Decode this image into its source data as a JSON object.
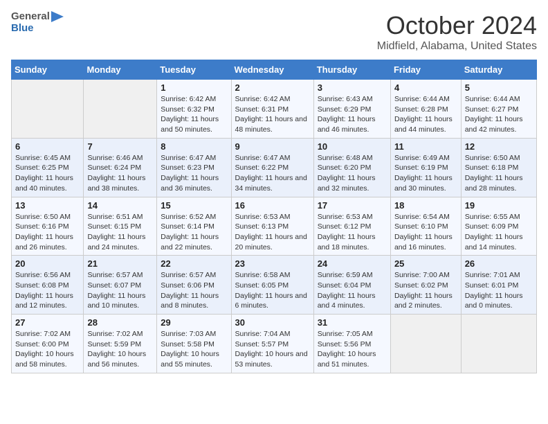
{
  "header": {
    "logo_general": "General",
    "logo_blue": "Blue",
    "month_title": "October 2024",
    "location": "Midfield, Alabama, United States"
  },
  "days_of_week": [
    "Sunday",
    "Monday",
    "Tuesday",
    "Wednesday",
    "Thursday",
    "Friday",
    "Saturday"
  ],
  "weeks": [
    [
      {
        "day": "",
        "info": ""
      },
      {
        "day": "",
        "info": ""
      },
      {
        "day": "1",
        "info": "Sunrise: 6:42 AM\nSunset: 6:32 PM\nDaylight: 11 hours and 50 minutes."
      },
      {
        "day": "2",
        "info": "Sunrise: 6:42 AM\nSunset: 6:31 PM\nDaylight: 11 hours and 48 minutes."
      },
      {
        "day": "3",
        "info": "Sunrise: 6:43 AM\nSunset: 6:29 PM\nDaylight: 11 hours and 46 minutes."
      },
      {
        "day": "4",
        "info": "Sunrise: 6:44 AM\nSunset: 6:28 PM\nDaylight: 11 hours and 44 minutes."
      },
      {
        "day": "5",
        "info": "Sunrise: 6:44 AM\nSunset: 6:27 PM\nDaylight: 11 hours and 42 minutes."
      }
    ],
    [
      {
        "day": "6",
        "info": "Sunrise: 6:45 AM\nSunset: 6:25 PM\nDaylight: 11 hours and 40 minutes."
      },
      {
        "day": "7",
        "info": "Sunrise: 6:46 AM\nSunset: 6:24 PM\nDaylight: 11 hours and 38 minutes."
      },
      {
        "day": "8",
        "info": "Sunrise: 6:47 AM\nSunset: 6:23 PM\nDaylight: 11 hours and 36 minutes."
      },
      {
        "day": "9",
        "info": "Sunrise: 6:47 AM\nSunset: 6:22 PM\nDaylight: 11 hours and 34 minutes."
      },
      {
        "day": "10",
        "info": "Sunrise: 6:48 AM\nSunset: 6:20 PM\nDaylight: 11 hours and 32 minutes."
      },
      {
        "day": "11",
        "info": "Sunrise: 6:49 AM\nSunset: 6:19 PM\nDaylight: 11 hours and 30 minutes."
      },
      {
        "day": "12",
        "info": "Sunrise: 6:50 AM\nSunset: 6:18 PM\nDaylight: 11 hours and 28 minutes."
      }
    ],
    [
      {
        "day": "13",
        "info": "Sunrise: 6:50 AM\nSunset: 6:16 PM\nDaylight: 11 hours and 26 minutes."
      },
      {
        "day": "14",
        "info": "Sunrise: 6:51 AM\nSunset: 6:15 PM\nDaylight: 11 hours and 24 minutes."
      },
      {
        "day": "15",
        "info": "Sunrise: 6:52 AM\nSunset: 6:14 PM\nDaylight: 11 hours and 22 minutes."
      },
      {
        "day": "16",
        "info": "Sunrise: 6:53 AM\nSunset: 6:13 PM\nDaylight: 11 hours and 20 minutes."
      },
      {
        "day": "17",
        "info": "Sunrise: 6:53 AM\nSunset: 6:12 PM\nDaylight: 11 hours and 18 minutes."
      },
      {
        "day": "18",
        "info": "Sunrise: 6:54 AM\nSunset: 6:10 PM\nDaylight: 11 hours and 16 minutes."
      },
      {
        "day": "19",
        "info": "Sunrise: 6:55 AM\nSunset: 6:09 PM\nDaylight: 11 hours and 14 minutes."
      }
    ],
    [
      {
        "day": "20",
        "info": "Sunrise: 6:56 AM\nSunset: 6:08 PM\nDaylight: 11 hours and 12 minutes."
      },
      {
        "day": "21",
        "info": "Sunrise: 6:57 AM\nSunset: 6:07 PM\nDaylight: 11 hours and 10 minutes."
      },
      {
        "day": "22",
        "info": "Sunrise: 6:57 AM\nSunset: 6:06 PM\nDaylight: 11 hours and 8 minutes."
      },
      {
        "day": "23",
        "info": "Sunrise: 6:58 AM\nSunset: 6:05 PM\nDaylight: 11 hours and 6 minutes."
      },
      {
        "day": "24",
        "info": "Sunrise: 6:59 AM\nSunset: 6:04 PM\nDaylight: 11 hours and 4 minutes."
      },
      {
        "day": "25",
        "info": "Sunrise: 7:00 AM\nSunset: 6:02 PM\nDaylight: 11 hours and 2 minutes."
      },
      {
        "day": "26",
        "info": "Sunrise: 7:01 AM\nSunset: 6:01 PM\nDaylight: 11 hours and 0 minutes."
      }
    ],
    [
      {
        "day": "27",
        "info": "Sunrise: 7:02 AM\nSunset: 6:00 PM\nDaylight: 10 hours and 58 minutes."
      },
      {
        "day": "28",
        "info": "Sunrise: 7:02 AM\nSunset: 5:59 PM\nDaylight: 10 hours and 56 minutes."
      },
      {
        "day": "29",
        "info": "Sunrise: 7:03 AM\nSunset: 5:58 PM\nDaylight: 10 hours and 55 minutes."
      },
      {
        "day": "30",
        "info": "Sunrise: 7:04 AM\nSunset: 5:57 PM\nDaylight: 10 hours and 53 minutes."
      },
      {
        "day": "31",
        "info": "Sunrise: 7:05 AM\nSunset: 5:56 PM\nDaylight: 10 hours and 51 minutes."
      },
      {
        "day": "",
        "info": ""
      },
      {
        "day": "",
        "info": ""
      }
    ]
  ]
}
